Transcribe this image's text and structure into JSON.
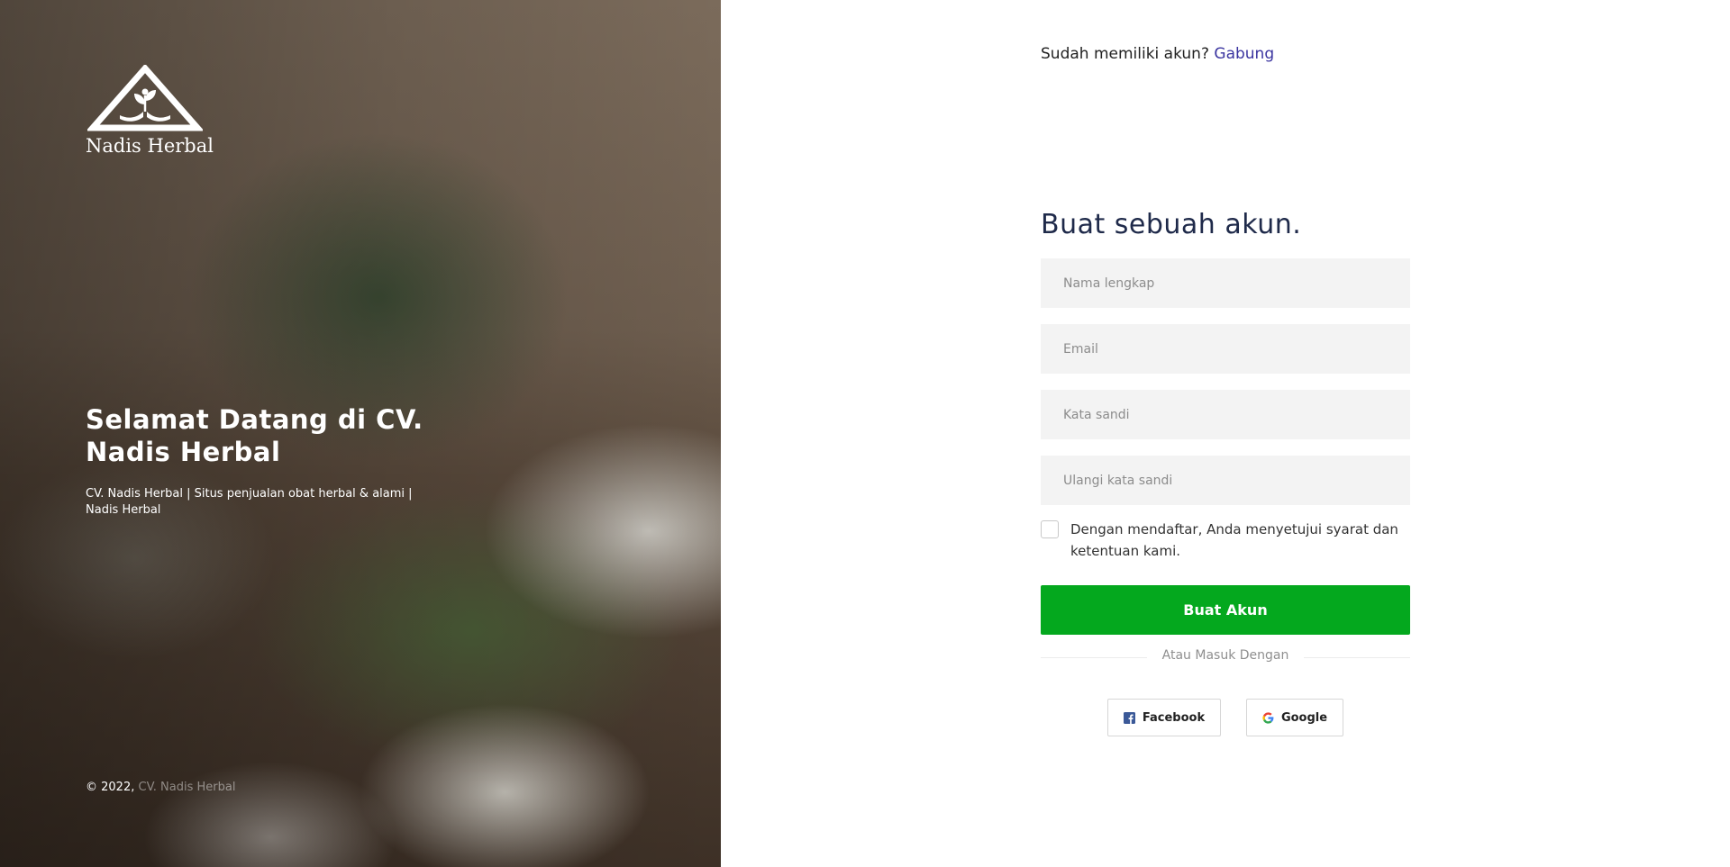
{
  "brand": {
    "logo_text": "Nadis Herbal"
  },
  "hero": {
    "title": "Selamat Datang di CV. Nadis Herbal",
    "subtitle": "CV. Nadis Herbal | Situs penjualan obat herbal & alami | Nadis Herbal"
  },
  "footer": {
    "copyright_prefix": "© 2022,",
    "company": "CV. Nadis Herbal"
  },
  "auth_prompt": {
    "text": "Sudah memiliki akun?",
    "link": "Gabung"
  },
  "form": {
    "title": "Buat sebuah akun.",
    "fields": {
      "full_name": {
        "placeholder": "Nama lengkap",
        "value": ""
      },
      "email": {
        "placeholder": "Email",
        "value": ""
      },
      "password": {
        "placeholder": "Kata sandi",
        "value": ""
      },
      "confirm_password": {
        "placeholder": "Ulangi kata sandi",
        "value": ""
      }
    },
    "terms_label": "Dengan mendaftar, Anda menyetujui syarat dan ketentuan kami.",
    "terms_checked": false,
    "submit_label": "Buat Akun",
    "divider_label": "Atau Masuk Dengan",
    "social": {
      "facebook_label": "Facebook",
      "google_label": "Google"
    }
  },
  "colors": {
    "primary_button": "#04a81e",
    "link": "#3b35a0",
    "title": "#1f2a4a",
    "field_background": "#f3f3f3",
    "facebook": "#3b5998"
  },
  "icons": {
    "logo": "triangle-hands-leaf-logo",
    "facebook": "facebook-icon",
    "google": "google-icon"
  }
}
